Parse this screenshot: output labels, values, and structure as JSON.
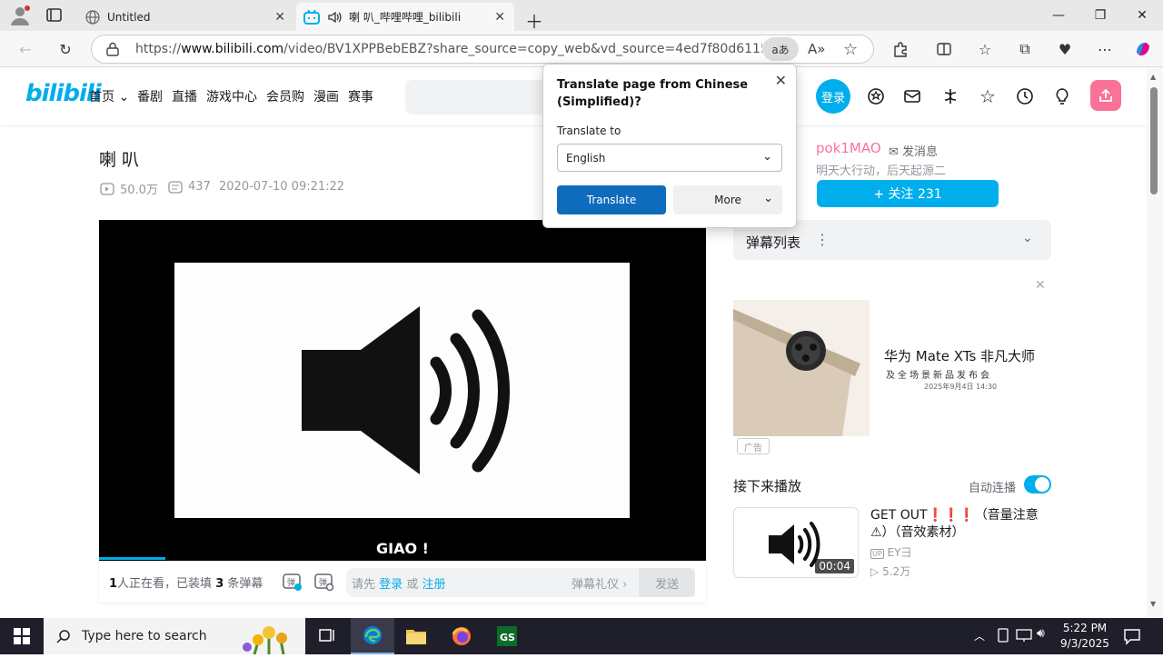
{
  "browser": {
    "tabs": [
      {
        "label": "Untitled"
      },
      {
        "label": "喇 叭_哔哩哔哩_bilibili"
      }
    ],
    "address": {
      "prefix": "https://",
      "domain": "www.bilibili.com",
      "rest": "/video/BV1XPPBebEBZ?share_source=copy_web&vd_source=4ed7f80d61155b7c7eee..."
    }
  },
  "translate_popup": {
    "heading": "Translate page from Chinese (Simplified)?",
    "to_label": "Translate to",
    "selected_language": "English",
    "translate_label": "Translate",
    "more_label": "More"
  },
  "site": {
    "logo": "bilibili",
    "nav": [
      "首页",
      "番剧",
      "直播",
      "游戏中心",
      "会员购",
      "漫画",
      "赛事"
    ],
    "login": "登录"
  },
  "video": {
    "title": "喇 叭",
    "views": "50.0万",
    "danmaku_count": "437",
    "date": "2020-07-10 09:21:22",
    "subtitle": "GIAO !",
    "progress": 0.11
  },
  "danmaku_bar": {
    "watching_count": "1",
    "watching_text": "人正在看，已装填",
    "loaded_count": "3",
    "loaded_suffix": "条弹幕",
    "prompt_prefix": "请先",
    "login_link": "登录",
    "or": "或",
    "register_link": "注册",
    "etiquette": "弹幕礼仪",
    "send": "发送"
  },
  "uploader": {
    "name": "pok1MAO",
    "message": "发消息",
    "signature": "明天大行动，后天起源二",
    "follow": "+ 关注 231"
  },
  "danmaku_list": {
    "label": "弹幕列表"
  },
  "ad": {
    "headline": "华为 Mate XTs  非凡大师",
    "subline": "及全场景新品发布会",
    "date": "2025年9月4日  14:30",
    "tag": "广告"
  },
  "next_up": {
    "header": "接下来播放",
    "autoplay": "自动连播",
    "item": {
      "title": "GET OUT❗❗❗（音量注意⚠）（音效素材）",
      "uploader": "EY彐",
      "views": "5.2万",
      "duration": "00:04"
    }
  },
  "taskbar": {
    "search_placeholder": "Type here to search",
    "time": "5:22 PM",
    "date": "9/3/2025"
  },
  "colors": {
    "bili_blue": "#00aeec",
    "bili_pink": "#fb7299",
    "edge_blue": "#0f6cbd"
  }
}
